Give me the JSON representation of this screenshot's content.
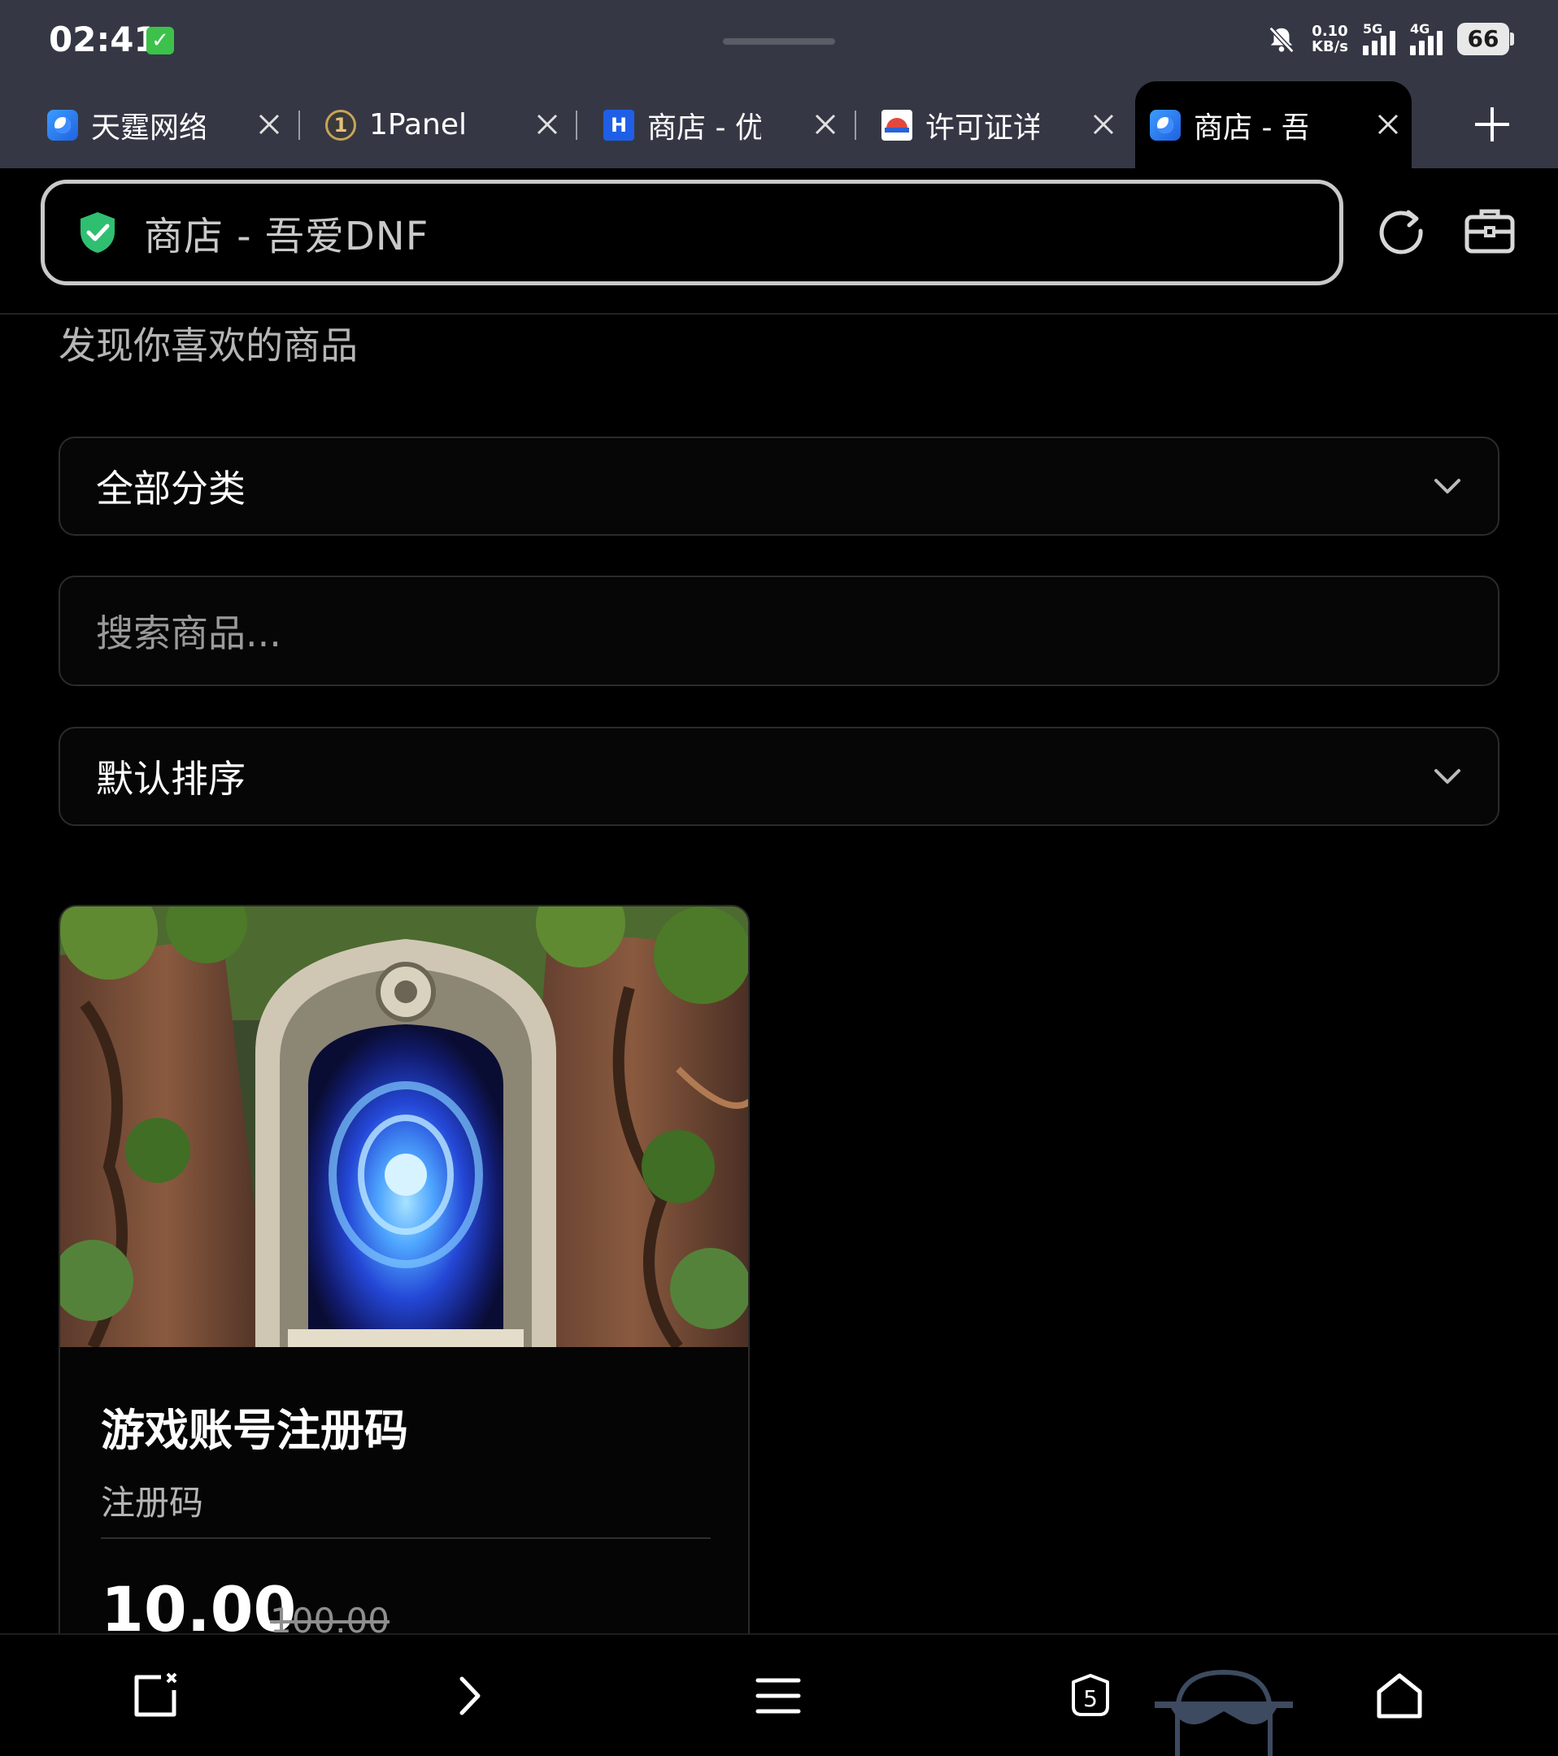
{
  "status_bar": {
    "time": "02:41",
    "net_speed_value": "0.10",
    "net_speed_unit": "KB/s",
    "signal_1_label": "5G",
    "signal_2_label": "4G",
    "battery": "66"
  },
  "tabs": [
    {
      "title": "天霆网络",
      "favicon": "blue-browser-icon",
      "active": false
    },
    {
      "title": "1Panel",
      "favicon": "1panel-icon",
      "active": false
    },
    {
      "title": "商店 - 优",
      "favicon": "h-icon",
      "active": false
    },
    {
      "title": "许可证详",
      "favicon": "license-icon",
      "active": false
    },
    {
      "title": "商店 - 吾",
      "favicon": "blue-browser-icon",
      "active": true
    }
  ],
  "address_bar": {
    "text": "商店 - 吾爱DNF",
    "security_icon": "shield-check-icon"
  },
  "page": {
    "subtitle": "发现你喜欢的商品",
    "category_select": "全部分类",
    "search_placeholder": "搜索商品...",
    "sort_select": "默认排序"
  },
  "products": [
    {
      "title": "游戏账号注册码",
      "subtitle": "注册码",
      "price": "10.00",
      "original_price": "100.00",
      "image": "pixel-art-portal-in-forest"
    }
  ],
  "bottom_nav": {
    "tab_count": "5"
  },
  "colors": {
    "chrome_bg": "#353844",
    "page_bg": "#000000",
    "shield_green": "#2fbf71",
    "field_border": "#2b2b2b"
  }
}
